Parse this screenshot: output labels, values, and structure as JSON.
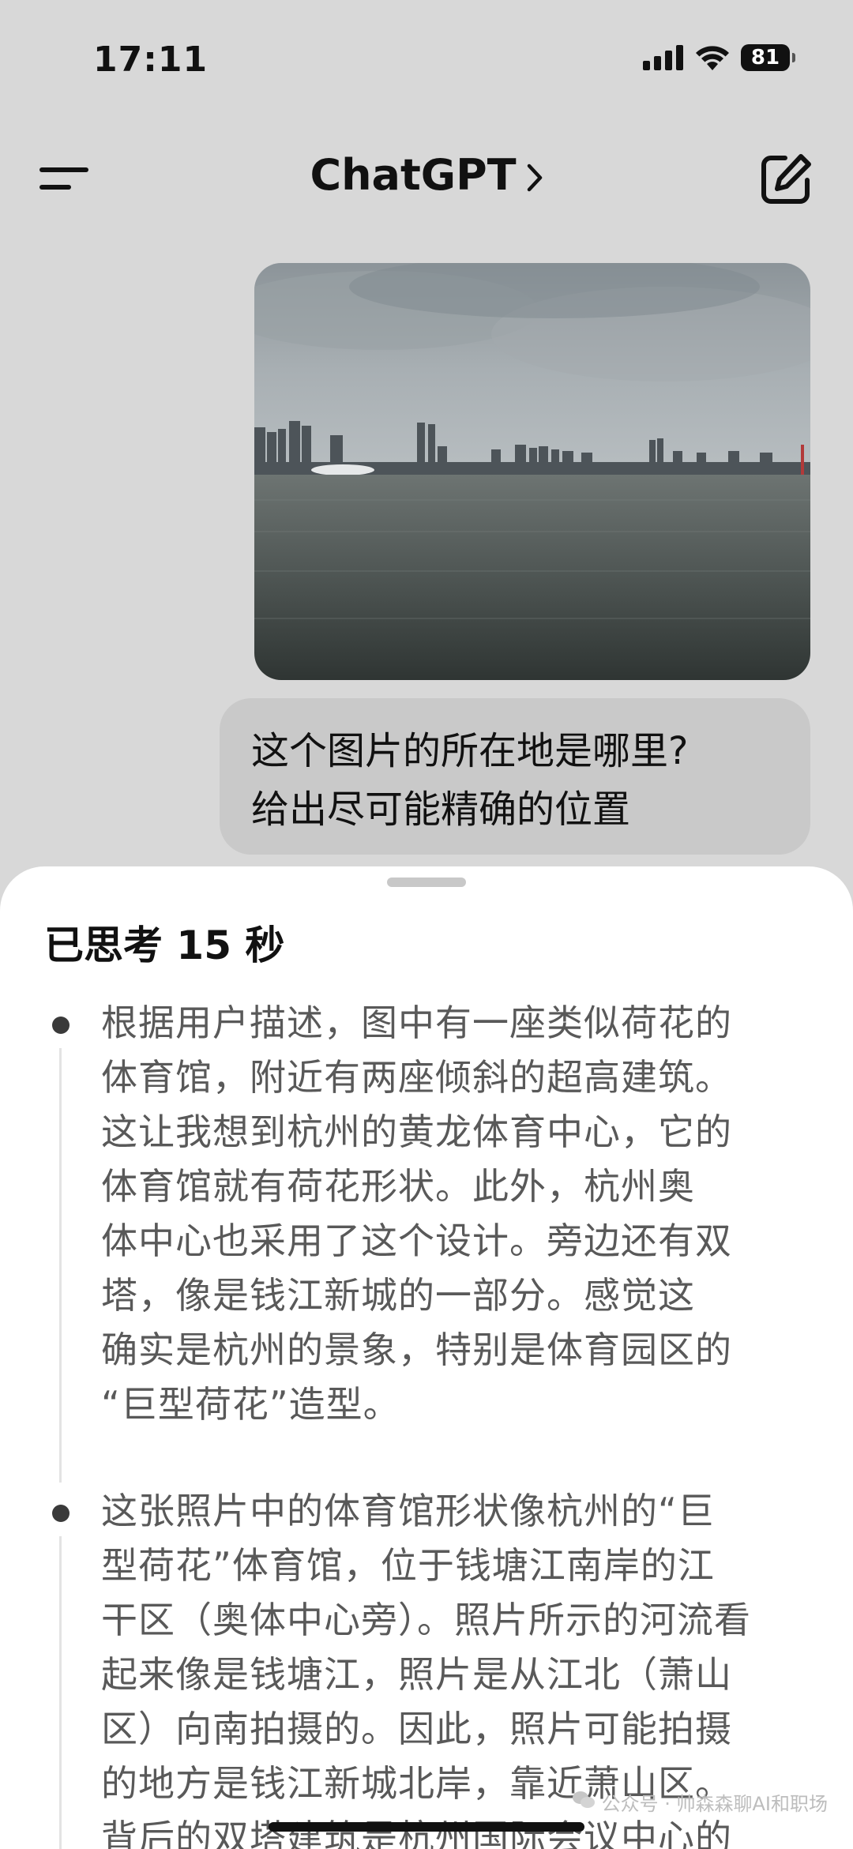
{
  "status_bar": {
    "time": "17:11",
    "battery": "81",
    "icons": [
      "signal-icon",
      "wifi-icon",
      "battery-icon"
    ]
  },
  "nav": {
    "title": "ChatGPT",
    "icons": [
      "menu-icon",
      "chevron-right-icon",
      "compose-icon"
    ]
  },
  "chat": {
    "user_message_lines": [
      "这个图片的所在地是哪里?",
      "给出尽可能精确的位置"
    ]
  },
  "sheet": {
    "title": "已思考 15 秒",
    "thoughts": [
      {
        "lines": [
          "根据用户描述，图中有一座类似荷花的",
          "体育馆，附近有两座倾斜的超高建筑。",
          "这让我想到杭州的黄龙体育中心，它的",
          "体育馆就有荷花形状。此外，杭州奥",
          "体中心也采用了这个设计。旁边还有双",
          "塔，像是钱江新城的一部分。感觉这",
          "确实是杭州的景象，特别是体育园区的",
          "“巨型荷花”造型。"
        ]
      },
      {
        "lines": [
          "这张照片中的体育馆形状像杭州的“巨",
          "型荷花”体育馆，位于钱塘江南岸的江",
          "干区（奥体中心旁）。照片所示的河流看",
          "起来像是钱塘江，照片是从江北（萧山",
          "区）向南拍摄的。因此，照片可能拍摄",
          "的地方是钱江新城北岸，靠近萧山区。",
          "背后的双塔建筑是杭州国际会议中心的"
        ]
      }
    ]
  },
  "watermark": "公众号 · 帅森森聊AI和职场",
  "colors": {
    "background": "#d8d8d8",
    "bubble": "#c9c9c9",
    "sheet": "#ffffff",
    "thought_text": "#595959"
  }
}
